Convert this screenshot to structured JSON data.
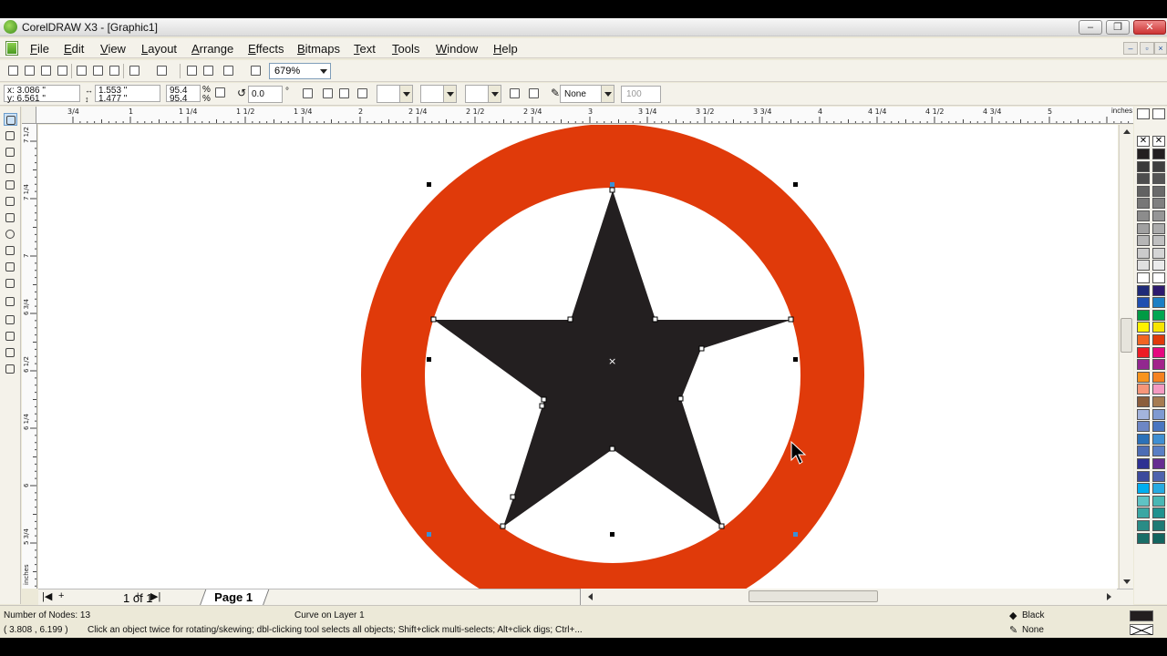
{
  "window": {
    "title": "CorelDRAW X3 - [Graphic1]",
    "minimize": "–",
    "restore": "❐",
    "close": "✕"
  },
  "menu": [
    "File",
    "Edit",
    "View",
    "Layout",
    "Arrange",
    "Effects",
    "Bitmaps",
    "Text",
    "Tools",
    "Window",
    "Help"
  ],
  "toolbar": {
    "zoom": "679%"
  },
  "properties": {
    "x": "x: 3.086 \"",
    "y": "y: 6.561 \"",
    "width": "1.553 \"",
    "height": "1.477 \"",
    "scale_w": "95.4",
    "scale_h": "95.4",
    "percent": "%",
    "rotation": "0.0",
    "degree": "°",
    "outline_width": "None",
    "transparency": "100"
  },
  "ruler": {
    "unit": "inches",
    "h_labels": [
      "3/4",
      "1",
      "1 1/4",
      "1 1/2",
      "1 3/4",
      "2",
      "2 1/4",
      "2 1/2",
      "2 3/4",
      "3",
      "3 1/4",
      "3 1/2",
      "3 3/4",
      "4",
      "4 1/4",
      "4 1/2",
      "4 3/4",
      "5"
    ],
    "v_labels": [
      "7 1/2",
      "7 1/4",
      "7",
      "6 3/4",
      "6 1/2",
      "6 1/4",
      "6",
      "5 3/4"
    ],
    "v_unit": "inches"
  },
  "drawing": {
    "ring_color": "#e03a0a",
    "star_color": "#231f20"
  },
  "palette_colors": [
    [
      "#231f20",
      "#231f20"
    ],
    [
      "#3a3a3a",
      "#404040"
    ],
    [
      "#4d4d4d",
      "#555555"
    ],
    [
      "#626262",
      "#6a6a6a"
    ],
    [
      "#777777",
      "#808080"
    ],
    [
      "#8c8c8c",
      "#969696"
    ],
    [
      "#a1a1a1",
      "#ababab"
    ],
    [
      "#b6b6b6",
      "#c0c0c0"
    ],
    [
      "#cbcbcb",
      "#d5d5d5"
    ],
    [
      "#e0e0e0",
      "#ebebeb"
    ],
    [
      "#ffffff",
      "#ffffff"
    ],
    [
      "#1e2a78",
      "#2d1a6e"
    ],
    [
      "#1f4fb0",
      "#1c7fc4"
    ],
    [
      "#009a44",
      "#00a651"
    ],
    [
      "#fff200",
      "#f7e400"
    ],
    [
      "#f26522",
      "#e03a0a"
    ],
    [
      "#ed1c24",
      "#e5097f"
    ],
    [
      "#92278f",
      "#a3248b"
    ],
    [
      "#f7941d",
      "#f58220"
    ],
    [
      "#f69679",
      "#f49ac1"
    ],
    [
      "#8b5e3c",
      "#a67c52"
    ],
    [
      "#a3b4dc",
      "#7f9ad2"
    ],
    [
      "#6d87c5",
      "#4a76c0"
    ],
    [
      "#2b71b8",
      "#3f8fd2"
    ],
    [
      "#4d6db4",
      "#5a7fc4"
    ],
    [
      "#2e3192",
      "#662d91"
    ],
    [
      "#3c4a9c",
      "#4f63ad"
    ],
    [
      "#00aeef",
      "#27aae1"
    ],
    [
      "#5fc3c4",
      "#49b7b4"
    ],
    [
      "#3aa7a3",
      "#21928e"
    ],
    [
      "#2a8c86",
      "#1f7a74"
    ],
    [
      "#1a6e68",
      "#136560"
    ]
  ],
  "page": {
    "count": "1 of 1",
    "tab": "Page 1"
  },
  "status": {
    "nodes": "Number of Nodes: 13",
    "object": "Curve on Layer 1",
    "coords": "( 3.808 , 6.199 )",
    "hint": "Click an object twice for rotating/skewing; dbl-clicking tool selects all objects; Shift+click multi-selects; Alt+click digs; Ctrl+...",
    "fill": "Black",
    "outline": "None"
  }
}
